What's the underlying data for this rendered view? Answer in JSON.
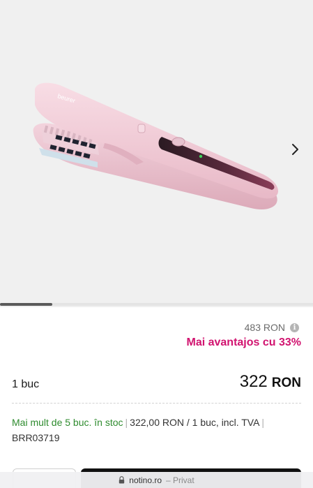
{
  "gallery": {
    "brand_text": "beurer",
    "next_icon": "chevron-right-icon",
    "progress_fraction": 0.167
  },
  "pricing": {
    "old_price": "483 RON",
    "info_icon": "info-icon",
    "discount_text": "Mai avantajos cu 33%",
    "quantity": "1 buc",
    "price_value": "322",
    "price_currency": "RON"
  },
  "availability": {
    "stock_text": "Mai mult de 5 buc. în stoc",
    "unit_price_text": "322,00 RON / 1 buc, incl. TVA",
    "code": "BRR03719"
  },
  "browser": {
    "domain": "notino.ro",
    "mode": "– Privat",
    "lock_icon": "lock-icon"
  },
  "colors": {
    "discount": "#d1136f",
    "stock": "#2e8b2e",
    "gallery_bg": "#f0f0f0",
    "product": "#f2cdd8"
  }
}
